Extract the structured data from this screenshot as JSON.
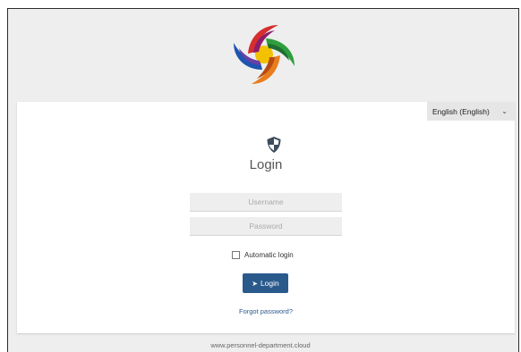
{
  "language": {
    "selected": "English (English)"
  },
  "login": {
    "title": "Login",
    "username_placeholder": "Username",
    "password_placeholder": "Password",
    "auto_login_label": "Automatic login",
    "login_button": "Login",
    "forgot_password": "Forgot password?"
  },
  "footer": {
    "domain": "www.personnel-department.cloud"
  },
  "colors": {
    "primary": "#2a5a8c",
    "background": "#eeeeee",
    "card": "#ffffff"
  },
  "icons": {
    "logo": "company-logo",
    "shield": "shield-icon",
    "login": "sign-in-icon",
    "chevron": "chevron-down-icon"
  }
}
